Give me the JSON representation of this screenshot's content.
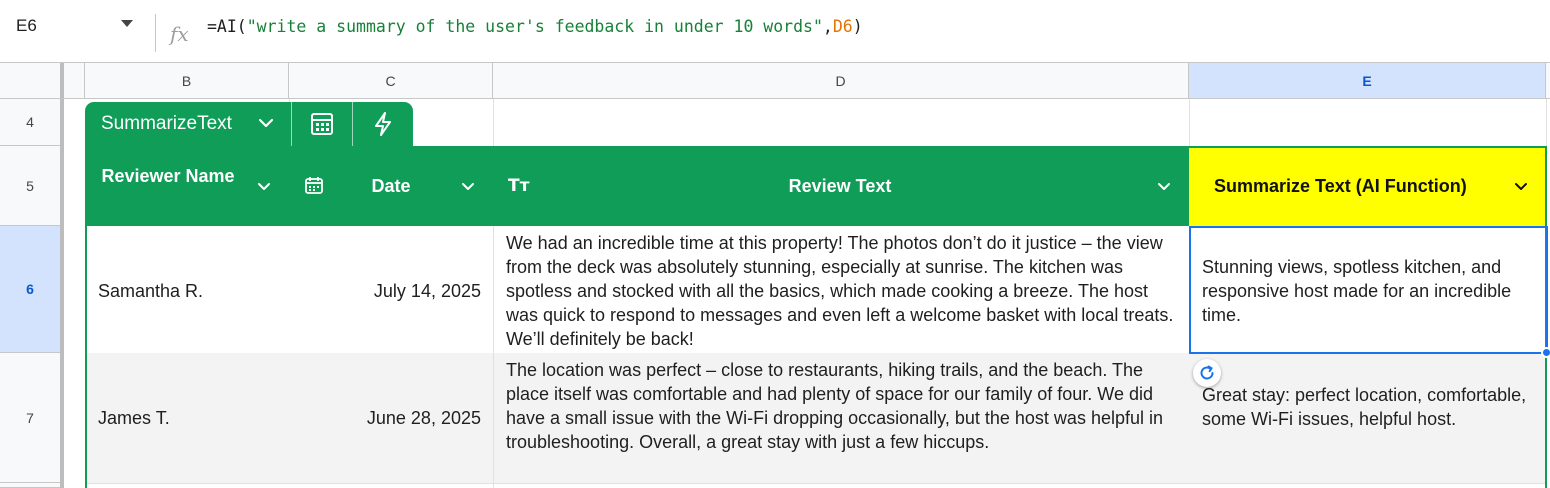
{
  "formula_bar": {
    "name_box": "E6",
    "fx_label": "fx",
    "formula_prefix": "=AI(",
    "formula_string": "\"write a summary of the user's feedback in under 10 words\"",
    "formula_sep": ",",
    "formula_ref": "D6",
    "formula_suffix": ")"
  },
  "columns": [
    "B",
    "C",
    "D",
    "E"
  ],
  "rows": [
    "4",
    "5",
    "6",
    "7"
  ],
  "table": {
    "name": "SummarizeText",
    "headers": {
      "name": "Reviewer Name",
      "date": "Date",
      "review": "Review Text",
      "summary": "Summarize Text (AI Function)"
    },
    "type_icon_text": "Tт",
    "data": [
      {
        "name": "Samantha R.",
        "date": "July 14, 2025",
        "review": "We had an incredible time at this property! The photos don’t do it justice – the view from the deck was absolutely stunning, especially at sunrise. The kitchen was spotless and stocked with all the basics, which made cooking a breeze. The host was quick to respond to messages and even left a welcome basket with local treats. We’ll definitely be back!",
        "summary": "Stunning views, spotless kitchen, and responsive host made for an incredible time."
      },
      {
        "name": "James T.",
        "date": "June 28, 2025",
        "review": "The location was perfect – close to restaurants, hiking trails, and the beach. The place itself was comfortable and had plenty of space for our family of four. We did have a small issue with the Wi-Fi dropping occasionally, but the host was helpful in troubleshooting. Overall, a great stay with just a few hiccups.",
        "summary": "Great stay: perfect location, comfortable, some Wi-Fi issues, helpful host."
      }
    ]
  },
  "colors": {
    "table_green": "#0f9d58",
    "ai_header_yellow": "#ffff00",
    "selection_blue": "#1a73e8"
  }
}
